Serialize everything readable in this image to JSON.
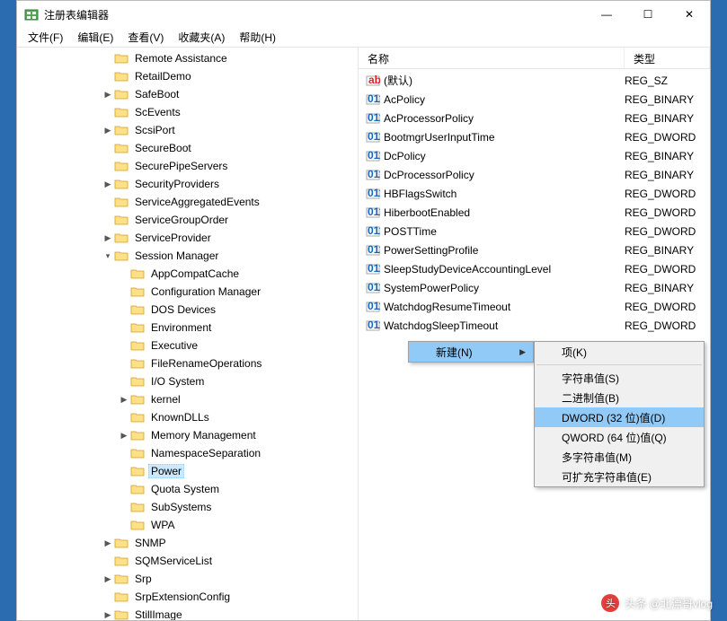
{
  "window": {
    "title": "注册表编辑器",
    "controls": {
      "minimize": "—",
      "maximize": "☐",
      "close": "✕"
    }
  },
  "menu": [
    "文件(F)",
    "编辑(E)",
    "查看(V)",
    "收藏夹(A)",
    "帮助(H)"
  ],
  "tree": [
    {
      "indent": 5,
      "toggle": "",
      "label": "Remote Assistance"
    },
    {
      "indent": 5,
      "toggle": "",
      "label": "RetailDemo"
    },
    {
      "indent": 5,
      "toggle": ">",
      "label": "SafeBoot"
    },
    {
      "indent": 5,
      "toggle": "",
      "label": "ScEvents"
    },
    {
      "indent": 5,
      "toggle": ">",
      "label": "ScsiPort"
    },
    {
      "indent": 5,
      "toggle": "",
      "label": "SecureBoot"
    },
    {
      "indent": 5,
      "toggle": "",
      "label": "SecurePipeServers"
    },
    {
      "indent": 5,
      "toggle": ">",
      "label": "SecurityProviders"
    },
    {
      "indent": 5,
      "toggle": "",
      "label": "ServiceAggregatedEvents"
    },
    {
      "indent": 5,
      "toggle": "",
      "label": "ServiceGroupOrder"
    },
    {
      "indent": 5,
      "toggle": ">",
      "label": "ServiceProvider"
    },
    {
      "indent": 5,
      "toggle": "v",
      "label": "Session Manager"
    },
    {
      "indent": 6,
      "toggle": "",
      "label": "AppCompatCache"
    },
    {
      "indent": 6,
      "toggle": "",
      "label": "Configuration Manager"
    },
    {
      "indent": 6,
      "toggle": "",
      "label": "DOS Devices"
    },
    {
      "indent": 6,
      "toggle": "",
      "label": "Environment"
    },
    {
      "indent": 6,
      "toggle": "",
      "label": "Executive"
    },
    {
      "indent": 6,
      "toggle": "",
      "label": "FileRenameOperations"
    },
    {
      "indent": 6,
      "toggle": "",
      "label": "I/O System"
    },
    {
      "indent": 6,
      "toggle": ">",
      "label": "kernel"
    },
    {
      "indent": 6,
      "toggle": "",
      "label": "KnownDLLs"
    },
    {
      "indent": 6,
      "toggle": ">",
      "label": "Memory Management"
    },
    {
      "indent": 6,
      "toggle": "",
      "label": "NamespaceSeparation"
    },
    {
      "indent": 6,
      "toggle": "",
      "label": "Power",
      "selected": true
    },
    {
      "indent": 6,
      "toggle": "",
      "label": "Quota System"
    },
    {
      "indent": 6,
      "toggle": "",
      "label": "SubSystems"
    },
    {
      "indent": 6,
      "toggle": "",
      "label": "WPA"
    },
    {
      "indent": 5,
      "toggle": ">",
      "label": "SNMP"
    },
    {
      "indent": 5,
      "toggle": "",
      "label": "SQMServiceList"
    },
    {
      "indent": 5,
      "toggle": ">",
      "label": "Srp"
    },
    {
      "indent": 5,
      "toggle": "",
      "label": "SrpExtensionConfig"
    },
    {
      "indent": 5,
      "toggle": ">",
      "label": "StillImage"
    }
  ],
  "list": {
    "headers": {
      "name": "名称",
      "type": "类型"
    },
    "rows": [
      {
        "icon": "str",
        "name": "(默认)",
        "type": "REG_SZ"
      },
      {
        "icon": "bin",
        "name": "AcPolicy",
        "type": "REG_BINARY"
      },
      {
        "icon": "bin",
        "name": "AcProcessorPolicy",
        "type": "REG_BINARY"
      },
      {
        "icon": "bin",
        "name": "BootmgrUserInputTime",
        "type": "REG_DWORD"
      },
      {
        "icon": "bin",
        "name": "DcPolicy",
        "type": "REG_BINARY"
      },
      {
        "icon": "bin",
        "name": "DcProcessorPolicy",
        "type": "REG_BINARY"
      },
      {
        "icon": "bin",
        "name": "HBFlagsSwitch",
        "type": "REG_DWORD"
      },
      {
        "icon": "bin",
        "name": "HiberbootEnabled",
        "type": "REG_DWORD"
      },
      {
        "icon": "bin",
        "name": "POSTTime",
        "type": "REG_DWORD"
      },
      {
        "icon": "bin",
        "name": "PowerSettingProfile",
        "type": "REG_BINARY"
      },
      {
        "icon": "bin",
        "name": "SleepStudyDeviceAccountingLevel",
        "type": "REG_DWORD"
      },
      {
        "icon": "bin",
        "name": "SystemPowerPolicy",
        "type": "REG_BINARY"
      },
      {
        "icon": "bin",
        "name": "WatchdogResumeTimeout",
        "type": "REG_DWORD"
      },
      {
        "icon": "bin",
        "name": "WatchdogSleepTimeout",
        "type": "REG_DWORD"
      }
    ]
  },
  "contextMenu1": [
    {
      "label": "新建(N)",
      "arrow": true,
      "hl": true
    }
  ],
  "contextMenu2": [
    {
      "label": "项(K)"
    },
    {
      "sep": true
    },
    {
      "label": "字符串值(S)"
    },
    {
      "label": "二进制值(B)"
    },
    {
      "label": "DWORD (32 位)值(D)",
      "hl": true
    },
    {
      "label": "QWORD (64 位)值(Q)"
    },
    {
      "label": "多字符串值(M)"
    },
    {
      "label": "可扩充字符串值(E)"
    }
  ],
  "watermark": {
    "badge": "头",
    "text": "头条 @北漂哥vlog"
  }
}
